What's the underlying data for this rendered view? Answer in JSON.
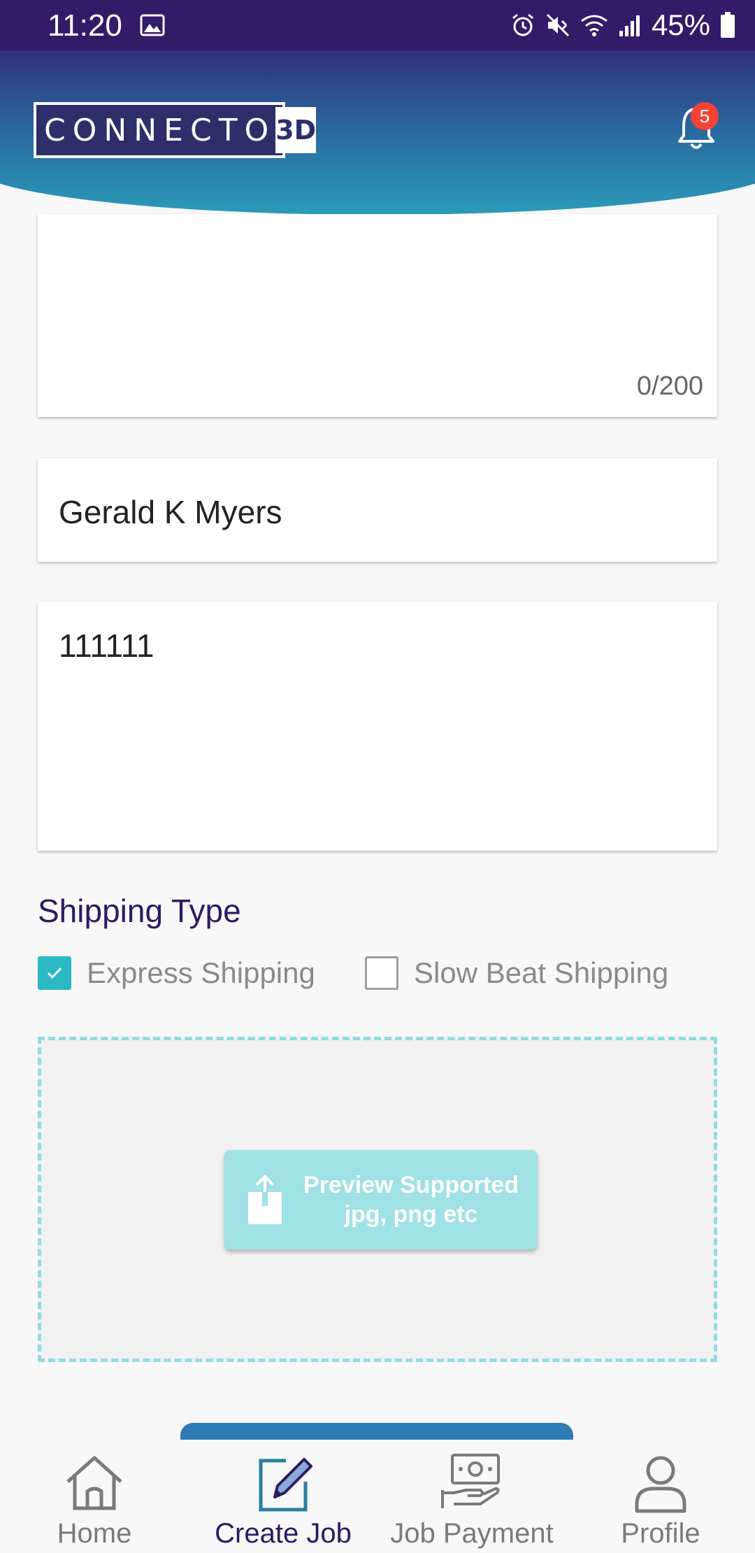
{
  "status_bar": {
    "time": "11:20",
    "battery": "45%"
  },
  "header": {
    "logo_text": "CONNECTO",
    "logo_mark": "3D",
    "notifications_count": "5"
  },
  "form": {
    "description_counter": "0/200",
    "name_value": "Gerald K Myers",
    "address_value": "111111"
  },
  "shipping": {
    "title": "Shipping Type",
    "options": [
      {
        "label": "Express Shipping",
        "checked": true
      },
      {
        "label": "Slow Beat Shipping",
        "checked": false
      }
    ]
  },
  "upload": {
    "line1": "Preview Supported",
    "line2": "jpg, png etc"
  },
  "bottom_nav": [
    {
      "label": "Home",
      "icon": "home-icon",
      "active": false
    },
    {
      "label": "Create Job",
      "icon": "edit-icon",
      "active": true
    },
    {
      "label": "Job Payment",
      "icon": "payment-icon",
      "active": false
    },
    {
      "label": "Profile",
      "icon": "profile-icon",
      "active": false
    }
  ],
  "colors": {
    "status_bar": "#331b68",
    "accent": "#2bb8c4",
    "primary": "#2e1a63",
    "badge": "#f44336"
  }
}
